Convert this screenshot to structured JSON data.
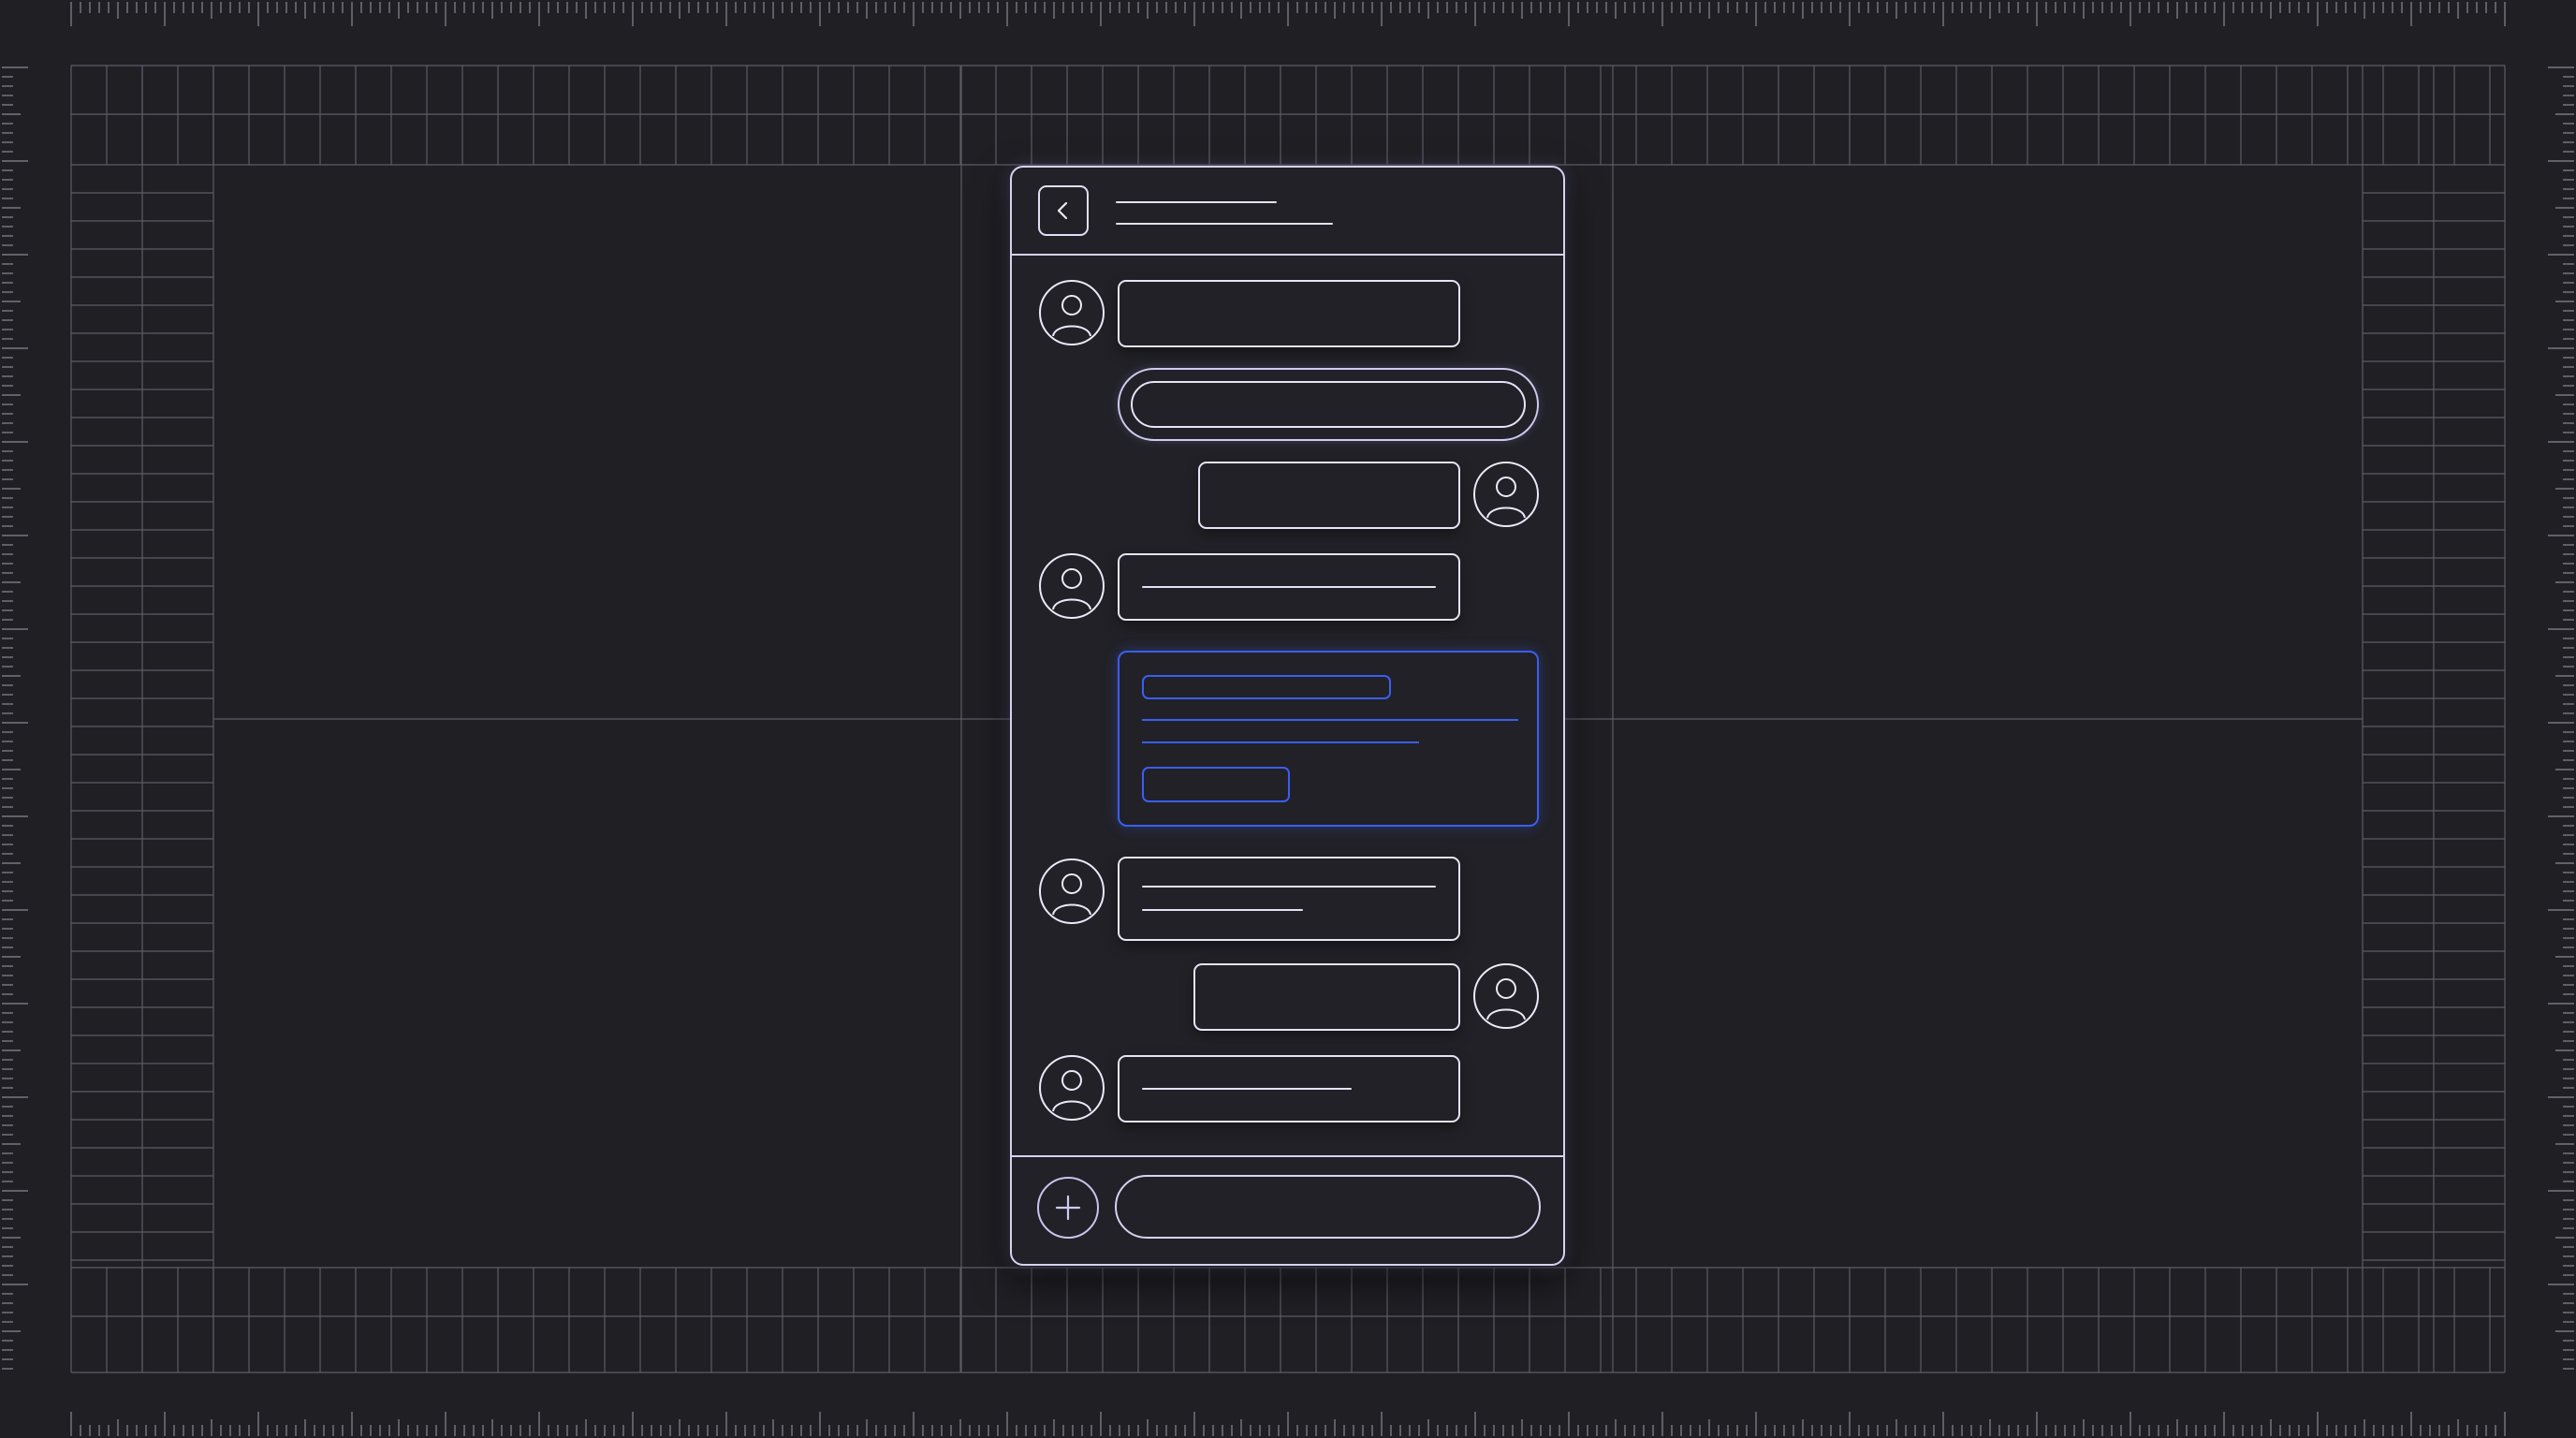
{
  "colors": {
    "background": "#1f1f24",
    "wireframe": "#e4e1f4",
    "accent": "#3b5ef0",
    "grid": "#6e6d78"
  },
  "icons": {
    "back": "chevron-left-icon",
    "avatar": "user-avatar-icon",
    "add": "plus-icon"
  }
}
